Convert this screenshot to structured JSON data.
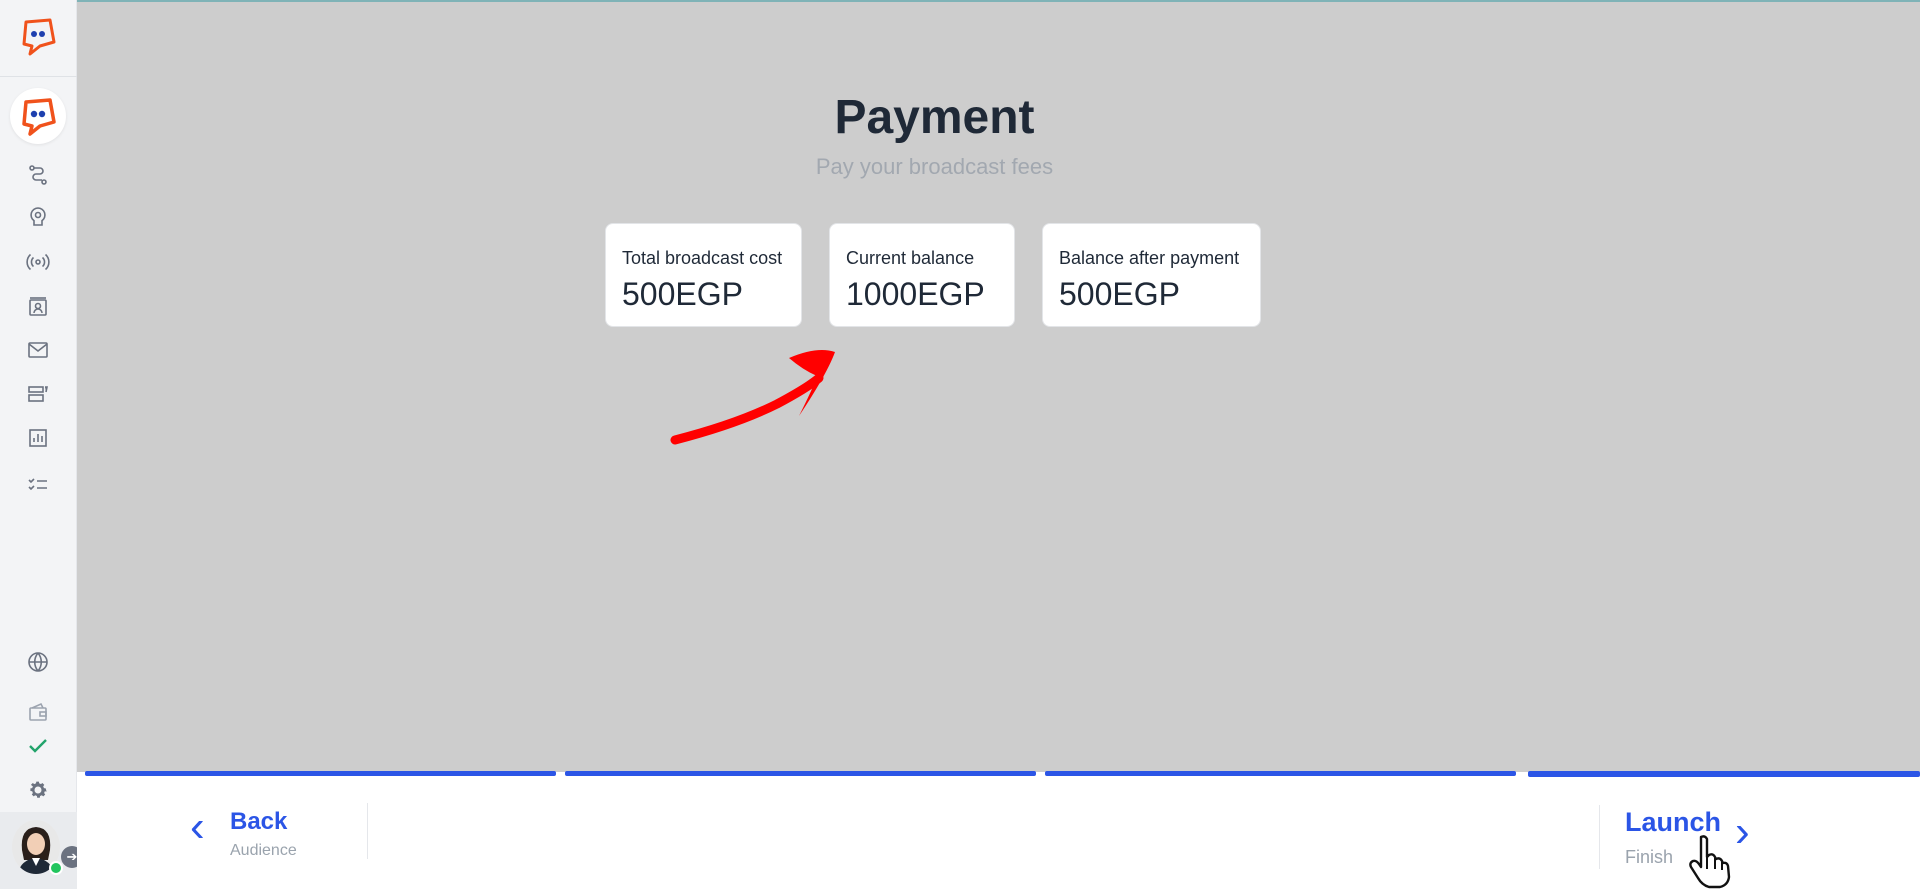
{
  "payment": {
    "title": "Payment",
    "subtitle": "Pay your broadcast fees",
    "cards": [
      {
        "label": "Total broadcast cost",
        "value": "500EGP"
      },
      {
        "label": "Current balance",
        "value": "1000EGP"
      },
      {
        "label": "Balance after payment",
        "value": "500EGP"
      }
    ]
  },
  "progress": {
    "steps_completed": 4,
    "steps_total": 4
  },
  "footer": {
    "back_label": "Back",
    "back_sub": "Audience",
    "launch_label": "Launch",
    "launch_sub": "Finish"
  },
  "sidebar": {
    "icons": [
      "logo-icon",
      "flow-icon",
      "bot-icon",
      "broadcast-icon",
      "contacts-icon",
      "mail-icon",
      "templates-icon",
      "analytics-icon",
      "tasks-icon",
      "globe-icon",
      "wallet-icon",
      "check-icon",
      "gear-icon"
    ]
  },
  "colors": {
    "accent": "#2b55e6",
    "brand_orange": "#f0521c",
    "arrow_red": "#ff0000"
  }
}
